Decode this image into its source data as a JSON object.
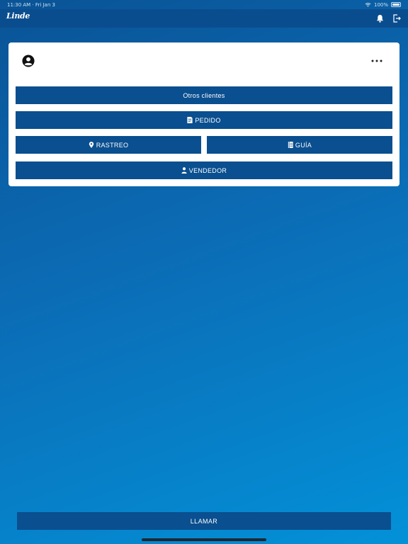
{
  "status": {
    "time": "11:30 AM",
    "date": "Fri Jan 3",
    "battery": "100%"
  },
  "header": {
    "logo": "Linde"
  },
  "card": {
    "otros_clientes": "Otros clientes",
    "pedido": "PEDIDO",
    "rastreo": "RASTREO",
    "guia": "GUÍA",
    "vendedor": "VENDEDOR"
  },
  "footer": {
    "llamar": "LLAMAR"
  },
  "icons": {
    "wifi": "wifi-icon",
    "battery": "battery-icon",
    "bell": "bell-icon",
    "logout": "logout-icon",
    "avatar": "account-circle-icon",
    "more": "more-horizontal-icon",
    "pedido": "document-icon",
    "rastreo": "map-pin-icon",
    "guia": "book-icon",
    "vendedor": "person-icon"
  },
  "colors": {
    "primary": "#0a4f8f",
    "topbar": "#0a4d8e",
    "card": "#ffffff"
  }
}
